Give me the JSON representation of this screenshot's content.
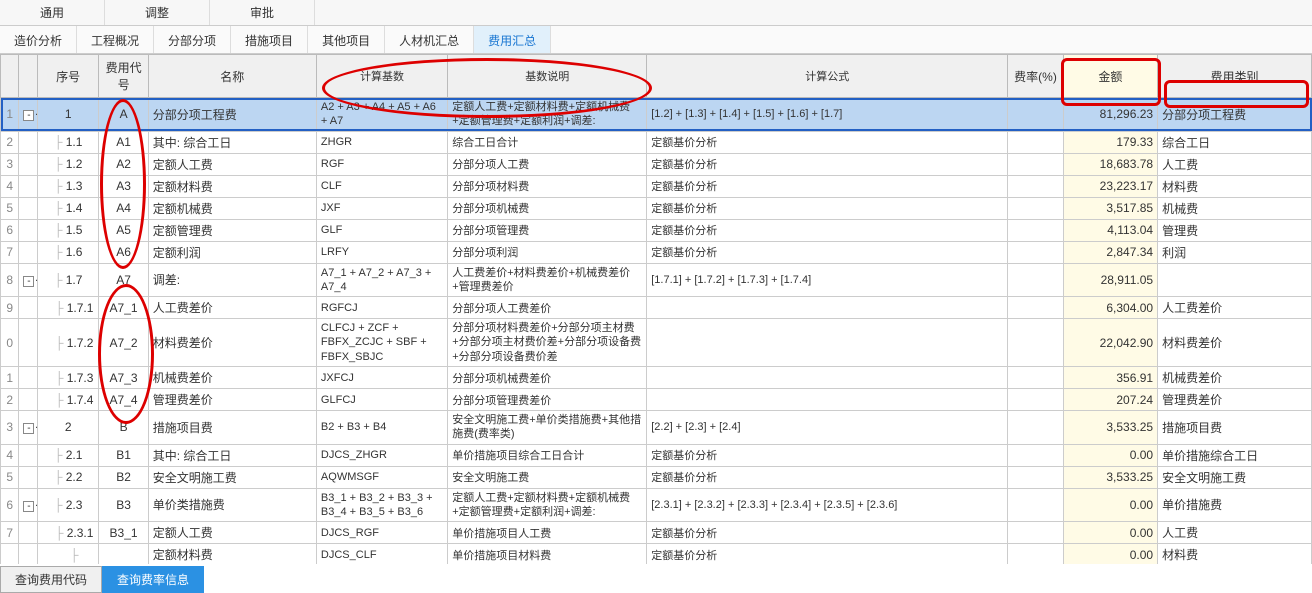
{
  "topTabs": [
    "通用",
    "调整",
    "审批"
  ],
  "subTabs": [
    "造价分析",
    "工程概况",
    "分部分项",
    "措施项目",
    "其他项目",
    "人材机汇总",
    "费用汇总"
  ],
  "activeSubTab": 6,
  "headers": {
    "seq": "序号",
    "code": "费用代号",
    "name": "名称",
    "calc": "计算基数",
    "desc": "基数说明",
    "formula": "计算公式",
    "rate": "费率(%)",
    "amt": "金额",
    "cat": "费用类别"
  },
  "rows": [
    {
      "idx": "1",
      "exp": "-",
      "seq": "1",
      "code": "A",
      "name": "分部分项工程费",
      "calc": "A2 + A3 + A4 + A5 + A6 + A7",
      "desc": "定额人工费+定额材料费+定额机械费+定额管理费+定额利润+调差:",
      "formula": "[1.2] + [1.3] + [1.4] + [1.5] + [1.6] + [1.7]",
      "rate": "",
      "amt": "81,296.23",
      "cat": "分部分项工程费",
      "sel": true,
      "wrap": true
    },
    {
      "idx": "2",
      "exp": "",
      "seq": "1.1",
      "code": "A1",
      "name": "其中: 综合工日",
      "calc": "ZHGR",
      "desc": "综合工日合计",
      "formula": "定额基价分析",
      "rate": "",
      "amt": "179.33",
      "cat": "综合工日",
      "ind": 1
    },
    {
      "idx": "3",
      "exp": "",
      "seq": "1.2",
      "code": "A2",
      "name": "定额人工费",
      "calc": "RGF",
      "desc": "分部分项人工费",
      "formula": "定额基价分析",
      "rate": "",
      "amt": "18,683.78",
      "cat": "人工费",
      "ind": 1
    },
    {
      "idx": "4",
      "exp": "",
      "seq": "1.3",
      "code": "A3",
      "name": "定额材料费",
      "calc": "CLF",
      "desc": "分部分项材料费",
      "formula": "定额基价分析",
      "rate": "",
      "amt": "23,223.17",
      "cat": "材料费",
      "ind": 1
    },
    {
      "idx": "5",
      "exp": "",
      "seq": "1.4",
      "code": "A4",
      "name": "定额机械费",
      "calc": "JXF",
      "desc": "分部分项机械费",
      "formula": "定额基价分析",
      "rate": "",
      "amt": "3,517.85",
      "cat": "机械费",
      "ind": 1
    },
    {
      "idx": "6",
      "exp": "",
      "seq": "1.5",
      "code": "A5",
      "name": "定额管理费",
      "calc": "GLF",
      "desc": "分部分项管理费",
      "formula": "定额基价分析",
      "rate": "",
      "amt": "4,113.04",
      "cat": "管理费",
      "ind": 1
    },
    {
      "idx": "7",
      "exp": "",
      "seq": "1.6",
      "code": "A6",
      "name": "定额利润",
      "calc": "LRFY",
      "desc": "分部分项利润",
      "formula": "定额基价分析",
      "rate": "",
      "amt": "2,847.34",
      "cat": "利润",
      "ind": 1
    },
    {
      "idx": "8",
      "exp": "-",
      "seq": "1.7",
      "code": "A7",
      "name": "调差:",
      "calc": "A7_1 + A7_2 + A7_3 + A7_4",
      "desc": "人工费差价+材料费差价+机械费差价+管理费差价",
      "formula": "[1.7.1] + [1.7.2] + [1.7.3] + [1.7.4]",
      "rate": "",
      "amt": "28,911.05",
      "cat": "",
      "ind": 1,
      "wrap": true
    },
    {
      "idx": "9",
      "exp": "",
      "seq": "1.7.1",
      "code": "A7_1",
      "name": "人工费差价",
      "calc": "RGFCJ",
      "desc": "分部分项人工费差价",
      "formula": "",
      "rate": "",
      "amt": "6,304.00",
      "cat": "人工费差价",
      "ind": 2
    },
    {
      "idx": "0",
      "exp": "",
      "seq": "1.7.2",
      "code": "A7_2",
      "name": "材料费差价",
      "calc": "CLFCJ + ZCF + FBFX_ZCJC + SBF + FBFX_SBJC",
      "desc": "分部分项材料费差价+分部分项主材费+分部分项主材费价差+分部分项设备费+分部分项设备费价差",
      "formula": "",
      "rate": "",
      "amt": "22,042.90",
      "cat": "材料费差价",
      "ind": 2,
      "wrap": true
    },
    {
      "idx": "1",
      "exp": "",
      "seq": "1.7.3",
      "code": "A7_3",
      "name": "机械费差价",
      "calc": "JXFCJ",
      "desc": "分部分项机械费差价",
      "formula": "",
      "rate": "",
      "amt": "356.91",
      "cat": "机械费差价",
      "ind": 2
    },
    {
      "idx": "2",
      "exp": "",
      "seq": "1.7.4",
      "code": "A7_4",
      "name": "管理费差价",
      "calc": "GLFCJ",
      "desc": "分部分项管理费差价",
      "formula": "",
      "rate": "",
      "amt": "207.24",
      "cat": "管理费差价",
      "ind": 2
    },
    {
      "idx": "3",
      "exp": "-",
      "seq": "2",
      "code": "B",
      "name": "措施项目费",
      "calc": "B2 + B3 + B4",
      "desc": "安全文明施工费+单价类措施费+其他措施费(费率类)",
      "formula": "[2.2] + [2.3] + [2.4]",
      "rate": "",
      "amt": "3,533.25",
      "cat": "措施项目费",
      "wrap": true
    },
    {
      "idx": "4",
      "exp": "",
      "seq": "2.1",
      "code": "B1",
      "name": "其中: 综合工日",
      "calc": "DJCS_ZHGR",
      "desc": "单价措施项目综合工日合计",
      "formula": "定额基价分析",
      "rate": "",
      "amt": "0.00",
      "cat": "单价措施综合工日",
      "ind": 1
    },
    {
      "idx": "5",
      "exp": "",
      "seq": "2.2",
      "code": "B2",
      "name": "安全文明施工费",
      "calc": "AQWMSGF",
      "desc": "安全文明施工费",
      "formula": "定额基价分析",
      "rate": "",
      "amt": "3,533.25",
      "cat": "安全文明施工费",
      "ind": 1
    },
    {
      "idx": "6",
      "exp": "-",
      "seq": "2.3",
      "code": "B3",
      "name": "单价类措施费",
      "calc": "B3_1 + B3_2 + B3_3 + B3_4 + B3_5 + B3_6",
      "desc": "定额人工费+定额材料费+定额机械费+定额管理费+定额利润+调差:",
      "formula": "[2.3.1] + [2.3.2] + [2.3.3] + [2.3.4] + [2.3.5] + [2.3.6]",
      "rate": "",
      "amt": "0.00",
      "cat": "单价措施费",
      "ind": 1,
      "wrap": true
    },
    {
      "idx": "7",
      "exp": "",
      "seq": "2.3.1",
      "code": "B3_1",
      "name": "定额人工费",
      "calc": "DJCS_RGF",
      "desc": "单价措施项目人工费",
      "formula": "定额基价分析",
      "rate": "",
      "amt": "0.00",
      "cat": "人工费",
      "ind": 2
    },
    {
      "idx": "",
      "exp": "",
      "seq": "",
      "code": "",
      "name": "定额材料费",
      "calc": "DJCS_CLF",
      "desc": "单价措施项目材料费",
      "formula": "定额基价分析",
      "rate": "",
      "amt": "0.00",
      "cat": "材料费",
      "ind": 2
    }
  ],
  "footerBtns": {
    "query_code": "查询费用代码",
    "query_rate": "查询费率信息"
  }
}
